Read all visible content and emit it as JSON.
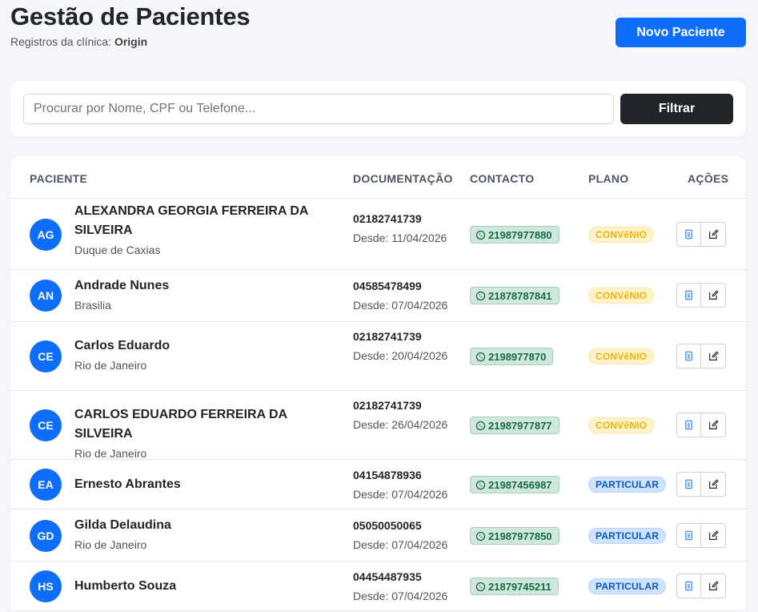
{
  "header": {
    "title": "Gestão de Pacientes",
    "subtitle_prefix": "Registros da clínica: ",
    "clinic": "Origin",
    "new_button": "Novo Paciente"
  },
  "search": {
    "placeholder": "Procurar por Nome, CPF ou Telefone...",
    "filter_button": "Filtrar"
  },
  "table": {
    "columns": {
      "patient": "PACIENTE",
      "documentation": "DOCUMENTAÇÃO",
      "contact": "CONTACTO",
      "plan": "PLANO",
      "actions": "AÇÕES"
    },
    "rows": [
      {
        "initials": "AG",
        "name": "ALEXANDRA GEORGIA FERREIRA DA SILVEIRA",
        "city": "Duque de Caxias",
        "doc": "02182741739",
        "since": "Desde: 11/04/2026",
        "phone": "21987977880",
        "plan": "CONVêNIO",
        "plan_type": "conv"
      },
      {
        "initials": "AN",
        "name": "Andrade Nunes",
        "city": "Brasilia",
        "doc": "04585478499",
        "since": "Desde: 07/04/2026",
        "phone": "21878787841",
        "plan": "CONVêNIO",
        "plan_type": "conv"
      },
      {
        "initials": "CE",
        "name": "Carlos Eduardo",
        "city": "Rio de Janeiro",
        "doc": "02182741739",
        "since": "Desde: 20/04/2026",
        "phone": "2198977870",
        "plan": "CONVêNIO",
        "plan_type": "conv"
      },
      {
        "initials": "CE",
        "name": "CARLOS EDUARDO FERREIRA DA SILVEIRA",
        "city": "Rio de Janeiro",
        "doc": "02182741739",
        "since": "Desde: 26/04/2026",
        "phone": "21987977877",
        "plan": "CONVêNIO",
        "plan_type": "conv"
      },
      {
        "initials": "EA",
        "name": "Ernesto Abrantes",
        "city": "",
        "doc": "04154878936",
        "since": "Desde: 07/04/2026",
        "phone": "21987456987",
        "plan": "PARTICULAR",
        "plan_type": "part"
      },
      {
        "initials": "GD",
        "name": "Gilda Delaudina",
        "city": "Rio de Janeiro",
        "doc": "05050050065",
        "since": "Desde: 07/04/2026",
        "phone": "21987977850",
        "plan": "PARTICULAR",
        "plan_type": "part"
      },
      {
        "initials": "HS",
        "name": "Humberto Souza",
        "city": "",
        "doc": "04454487935",
        "since": "Desde: 07/04/2026",
        "phone": "21879745211",
        "plan": "PARTICULAR",
        "plan_type": "part"
      }
    ]
  },
  "colors": {
    "primary": "#0d6efd",
    "dark": "#212529",
    "success_bg": "#d1e7dd",
    "warning_text": "#f0b400",
    "info_bg": "#cfe2ff"
  },
  "icons": {
    "contact": "whatsapp-icon",
    "view": "document-icon",
    "edit": "edit-icon"
  }
}
